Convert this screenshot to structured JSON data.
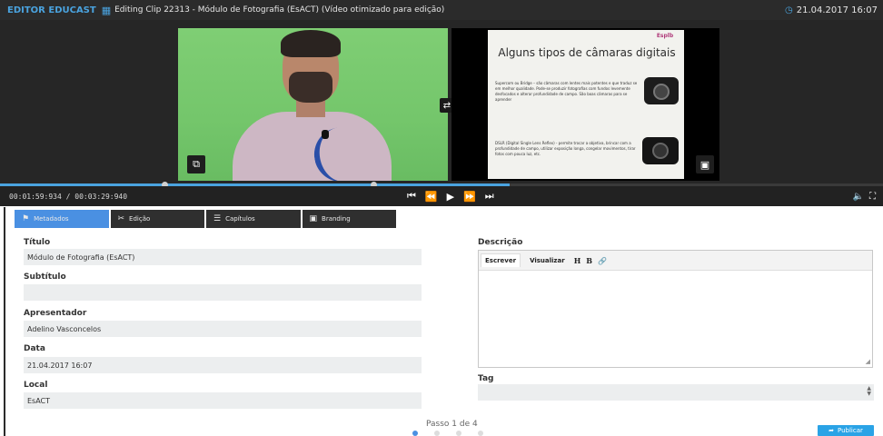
{
  "topbar": {
    "brand": "EDITOR EDUCAST",
    "title": "Editing Clip 22313 - Módulo de Fotografia (EsACT) (Vídeo otimizado para edição)",
    "datetime": "21.04.2017 16:07",
    "film_icon": "film-icon",
    "clock_icon": "clock-icon"
  },
  "slide": {
    "title": "Alguns tipos de câmaras digitais",
    "logo": "Esplb",
    "bullet1": "Supercom ou Bridge – são câmaras com lentes mais potentes e que traduz se em melhor qualidade. Pode-se produzir fotografias com fundos levemente desfocados e alterar profundidade de campo. São boas câmaras para se aprender",
    "bullet2": "DSLR (Digital Single Lens Reflex) - permite trocar a objetiva, brincar com a profundidade de campo, utilizar exposição longa, congelar movimentos, tirar fotos com pouca luz, etc."
  },
  "player": {
    "time": "00:01:59:934 / 00:03:29:940",
    "progress": 0.577,
    "marker1": 0.186,
    "marker2": 0.423
  },
  "tabs": [
    {
      "label": "Metadados",
      "icon": "tag-icon"
    },
    {
      "label": "Edição",
      "icon": "scissors-icon"
    },
    {
      "label": "Capítulos",
      "icon": "layers-icon"
    },
    {
      "label": "Branding",
      "icon": "image-icon"
    }
  ],
  "form": {
    "titulo_label": "Título",
    "titulo_value": "Módulo de Fotografia (EsACT)",
    "subtitulo_label": "Subtítulo",
    "subtitulo_value": "",
    "apresentador_label": "Apresentador",
    "apresentador_value": "Adelino Vasconcelos",
    "data_label": "Data",
    "data_value": "21.04.2017 16:07",
    "local_label": "Local",
    "local_value": "EsACT",
    "descricao_label": "Descrição",
    "editor_write": "Escrever",
    "editor_preview": "Visualizar",
    "tool_h": "H",
    "tool_b": "B",
    "tag_label": "Tag"
  },
  "footer": {
    "step": "Passo 1 de 4",
    "publish": "Publicar"
  },
  "colors": {
    "accent": "#4a90e2",
    "brand": "#4aa3df",
    "publish": "#2aa3e6"
  }
}
